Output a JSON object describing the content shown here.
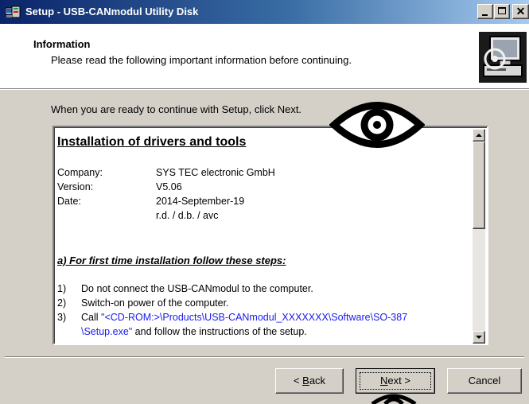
{
  "window": {
    "title": "Setup - USB-CANmodul Utility Disk",
    "close_glyph": "✕"
  },
  "header": {
    "title": "Information",
    "subtitle": "Please read the following important information before continuing."
  },
  "instruction": "When you are ready to continue with Setup, click Next.",
  "memo": {
    "title": "Installation of drivers and tools",
    "meta": [
      {
        "label": "Company:",
        "value": "SYS TEC electronic GmbH"
      },
      {
        "label": "Version:",
        "value": "V5.06"
      },
      {
        "label": "Date:",
        "value": "2014-September-19"
      },
      {
        "label": "",
        "value": "r.d. / d.b. / avc"
      }
    ],
    "section_heading": "a) For first time installation follow these steps:",
    "steps": [
      {
        "num": "1)",
        "text": "Do not connect the USB-CANmodul to the computer."
      },
      {
        "num": "2)",
        "text": "Switch-on power of the computer."
      },
      {
        "num": "3)",
        "text_prefix": "Call ",
        "link": "\"<CD-ROM:>\\Products\\USB-CANmodul_XXXXXXX\\Software\\SO-387",
        "link_cont": "\\Setup.exe\"",
        "text_suffix": " and follow the instructions of the setup."
      }
    ]
  },
  "buttons": {
    "back": {
      "prefix": "< ",
      "mnemonic": "B",
      "rest": "ack"
    },
    "next": {
      "mnemonic": "N",
      "rest": "ext >"
    },
    "cancel": "Cancel"
  },
  "icons": {
    "app": "setup-app-icon",
    "header": "computer-install-icon",
    "overlay": "eye-icon"
  },
  "colors": {
    "titlebar_start": "#0a246a",
    "titlebar_end": "#a6caf0",
    "link": "#1a1aee",
    "face": "#d4d0c8"
  }
}
